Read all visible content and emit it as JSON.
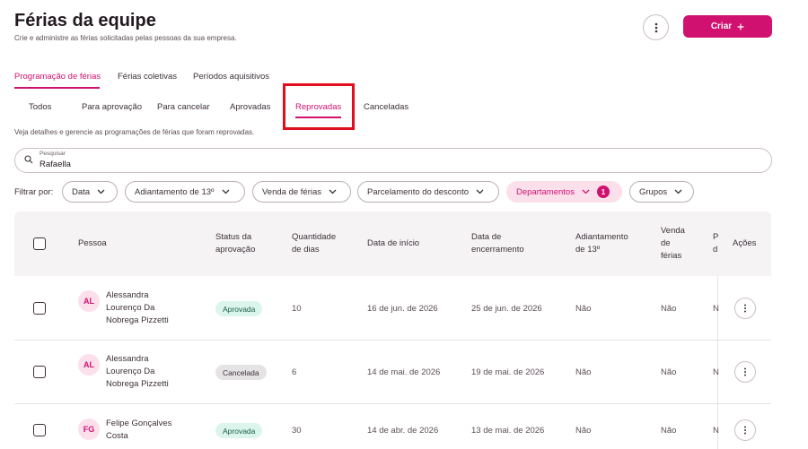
{
  "header": {
    "title": "Férias da equipe",
    "subtitle": "Crie e administre as férias solicitadas pelas pessoas da sua empresa.",
    "create_label": "Criar",
    "accent_color": "#d1116f"
  },
  "main_tabs": [
    {
      "label": "Programação de férias",
      "active": true
    },
    {
      "label": "Férias coletivas",
      "active": false
    },
    {
      "label": "Períodos aquisitivos",
      "active": false
    }
  ],
  "sub_tabs": [
    {
      "label": "Todos",
      "active": false
    },
    {
      "label": "Para aprovação",
      "active": false
    },
    {
      "label": "Para cancelar",
      "active": false
    },
    {
      "label": "Aprovadas",
      "active": false
    },
    {
      "label": "Reprovadas",
      "active": true
    },
    {
      "label": "Canceladas",
      "active": false
    }
  ],
  "description": "Veja detalhes e gerencie as programações de férias que foram reprovadas.",
  "search": {
    "label": "Pesquisar",
    "value": "Rafaella"
  },
  "filters": {
    "label": "Filtrar por:",
    "chips": [
      {
        "label": "Data",
        "active": false
      },
      {
        "label": "Adiantamento de 13º",
        "active": false
      },
      {
        "label": "Venda de férias",
        "active": false
      },
      {
        "label": "Parcelamento do desconto",
        "active": false
      },
      {
        "label": "Departamentos",
        "active": true,
        "badge": "1"
      },
      {
        "label": "Grupos",
        "active": false
      }
    ]
  },
  "table": {
    "columns": {
      "person": "Pessoa",
      "status_1": "Status da",
      "status_2": "aprovação",
      "days_1": "Quantidade",
      "days_2": "de dias",
      "start": "Data de início",
      "end_1": "Data de",
      "end_2": "encerramento",
      "advance_1": "Adiantamento",
      "advance_2": "de 13º",
      "sale_1": "Venda",
      "sale_2": "de",
      "sale_3": "férias",
      "cut_1": "P",
      "cut_2": "d",
      "actions": "Ações"
    },
    "rows": [
      {
        "initials": "AL",
        "name_1": "Alessandra",
        "name_2": "Lourenço Da",
        "name_3": "Nobrega Pizzetti",
        "status": "Aprovada",
        "days": "10",
        "start": "16 de jun. de 2026",
        "end": "25 de jun. de 2026",
        "advance": "Não",
        "sale": "Não",
        "cut": "N"
      },
      {
        "initials": "AL",
        "name_1": "Alessandra",
        "name_2": "Lourenço Da",
        "name_3": "Nobrega Pizzetti",
        "status": "Cancelada",
        "days": "6",
        "start": "14 de mai. de 2026",
        "end": "19 de mai. de 2026",
        "advance": "Não",
        "sale": "Não",
        "cut": "N"
      },
      {
        "initials": "FG",
        "name_1": "Felipe Gonçalves",
        "name_2": "Costa",
        "status": "Aprovada",
        "days": "30",
        "start": "14 de abr. de 2026",
        "end": "13 de mai. de 2026",
        "advance": "Não",
        "sale": "Não",
        "cut": "N"
      }
    ]
  }
}
